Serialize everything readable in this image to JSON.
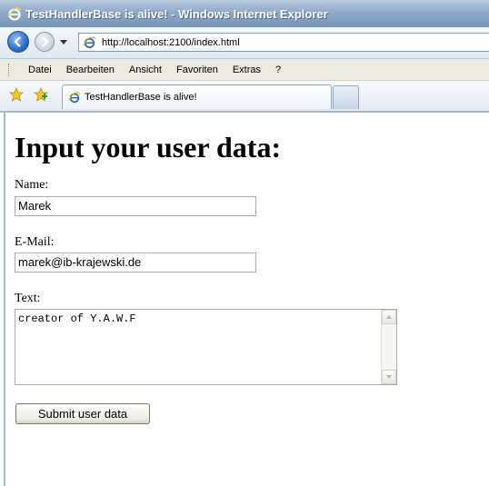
{
  "window": {
    "title": "TestHandlerBase is alive! - Windows Internet Explorer"
  },
  "address_bar": {
    "url": "http://localhost:2100/index.html"
  },
  "menu": {
    "items": [
      "Datei",
      "Bearbeiten",
      "Ansicht",
      "Favoriten",
      "Extras",
      "?"
    ]
  },
  "tabs": {
    "active_label": "TestHandlerBase is alive!"
  },
  "page": {
    "heading": "Input your user data:",
    "name_label": "Name:",
    "name_value": "Marek",
    "email_label": "E-Mail:",
    "email_value": "marek@ib-krajewski.de",
    "text_label": "Text:",
    "text_value": "creator of Y.A.W.F",
    "submit_label": "Submit user data"
  },
  "icons": {
    "browser": "ie-logo-icon",
    "back": "back-arrow-icon",
    "forward": "forward-arrow-icon",
    "favorites": "favorites-star-icon",
    "add_favorite": "add-favorite-icon"
  },
  "colors": {
    "titlebar": "#8fa9c8",
    "title_text": "#ffffff",
    "menubar": "#ece9e0",
    "input_border": "#a5acb2"
  }
}
